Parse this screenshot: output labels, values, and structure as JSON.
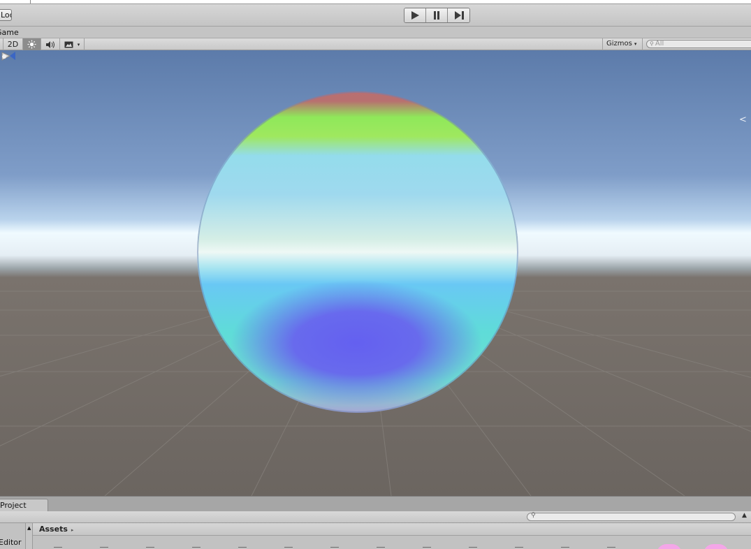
{
  "toolbar": {
    "pivot_label": "Local",
    "play_controls": [
      "play-icon",
      "pause-icon",
      "step-icon"
    ]
  },
  "tabs": {
    "game_tab": "Game"
  },
  "scene_bar": {
    "mode_2d": "2D",
    "lighting_icon": "sun-icon",
    "audio_icon": "speaker-icon",
    "effects_icon": "image-icon",
    "gizmos_label": "Gizmos",
    "search_placeholder": "All"
  },
  "viewport": {
    "object": "sphere",
    "sky_color": "#7f9dc8",
    "ground_color": "#6b6560"
  },
  "project": {
    "tab_label": "Project",
    "breadcrumb_root": "Assets",
    "tree_item": "Editor"
  }
}
